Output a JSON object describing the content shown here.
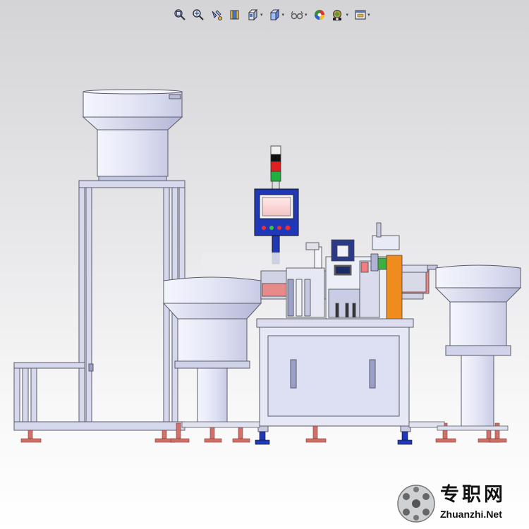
{
  "toolbar": {
    "items": [
      {
        "name": "zoom-to-fit",
        "icon": "zoom-fit-icon",
        "has_dropdown": false
      },
      {
        "name": "zoom-to-area",
        "icon": "zoom-area-icon",
        "has_dropdown": false
      },
      {
        "name": "previous-view",
        "icon": "previous-view-icon",
        "has_dropdown": false
      },
      {
        "name": "section-view",
        "icon": "section-view-icon",
        "has_dropdown": false
      },
      {
        "name": "view-orientation",
        "icon": "view-orientation-icon",
        "has_dropdown": true
      },
      {
        "name": "display-style",
        "icon": "display-style-icon",
        "has_dropdown": true
      },
      {
        "name": "hide-show-items",
        "icon": "hide-show-icon",
        "has_dropdown": true
      },
      {
        "name": "edit-appearance",
        "icon": "appearance-icon",
        "has_dropdown": false
      },
      {
        "name": "apply-scene",
        "icon": "scene-icon",
        "has_dropdown": true
      },
      {
        "name": "view-settings",
        "icon": "view-settings-icon",
        "has_dropdown": true
      }
    ]
  },
  "colors": {
    "frame_outline": "#5a5a66",
    "frame_fill": "#d6d8ee",
    "bowl_fill": "#eceefa",
    "foot_color": "#d0706a",
    "blue_parts": "#1f38b8",
    "orange_part": "#f08c1e",
    "signal_red": "#e02020",
    "signal_green": "#20b040"
  },
  "watermark": {
    "logo_text": "专职网",
    "url_text": "Zhuanzhi.Net"
  }
}
